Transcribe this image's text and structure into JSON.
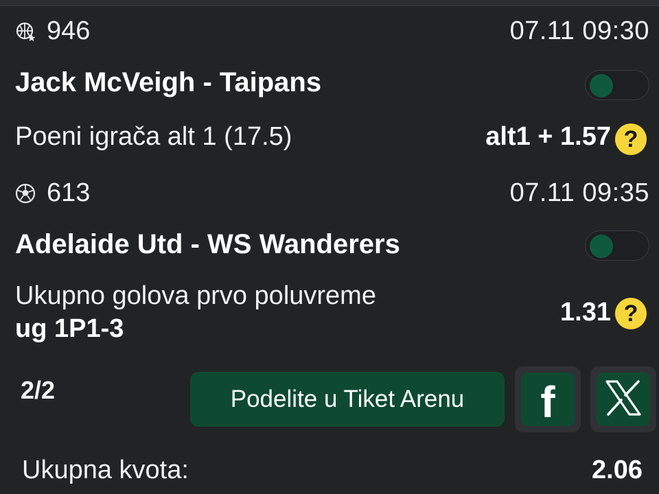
{
  "events": [
    {
      "sport_icon": "basketball-icon",
      "event_id": "946",
      "datetime": "07.11 09:30",
      "match": "Jack McVeigh - Taipans",
      "market": "Poeni igrača alt 1 (17.5)",
      "market_pick": "",
      "odds": "alt1 + 1.57",
      "toggle_on": false
    },
    {
      "sport_icon": "football-icon",
      "event_id": "613",
      "datetime": "07.11 09:35",
      "match": "Adelaide Utd - WS Wanderers",
      "market": "Ukupno golova prvo poluvreme",
      "market_pick": "ug 1P1-3",
      "odds": "1.31",
      "toggle_on": false
    }
  ],
  "help_glyph": "?",
  "page_counter": "2/2",
  "share_button_label": "Podelite u Tiket Arenu",
  "social": {
    "facebook_glyph": "f",
    "x_icon": "x-logo-icon"
  },
  "total": {
    "label": "Ukupna kvota:",
    "value": "2.06"
  },
  "colors": {
    "background": "#222325",
    "accent_green": "#0e4a32",
    "help_yellow": "#f6d63a"
  }
}
